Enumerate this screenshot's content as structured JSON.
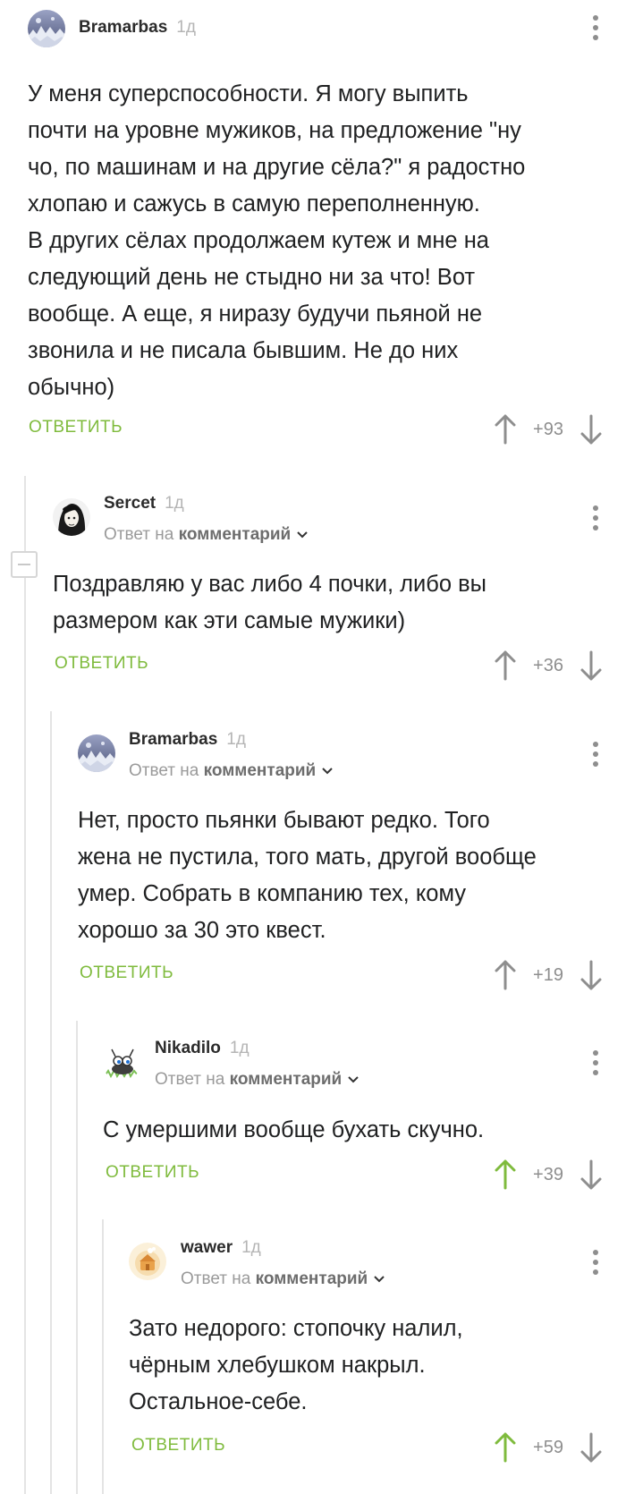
{
  "comments": [
    {
      "author": "Bramarbas",
      "age": "1д",
      "lines": [
        "У меня суперспособности. Я могу выпить",
        "почти на уровне мужиков, на предложение \"ну",
        "чо, по машинам и на другие сёла?\" я радостно",
        "хлопаю и сажусь в самую переполненную.",
        "В других сёлах продолжаем кутеж и мне на",
        "следующий день не стыдно ни за что! Вот",
        "вообще. А еще, я ниразу будучи пьяной не",
        "звонила и не писала бывшим. Не до них",
        "обычно)"
      ],
      "reply_label": "ОТВЕТИТЬ",
      "score": "+93",
      "upvoted": false
    },
    {
      "author": "Sercet",
      "age": "1д",
      "reply_prefix": "Ответ на",
      "reply_target": "комментарий",
      "lines": [
        "Поздравляю у вас либо 4 почки, либо вы",
        "размером как эти самые мужики)"
      ],
      "reply_label": "ОТВЕТИТЬ",
      "score": "+36",
      "upvoted": false
    },
    {
      "author": "Bramarbas",
      "age": "1д",
      "reply_prefix": "Ответ на",
      "reply_target": "комментарий",
      "lines": [
        "Нет, просто пьянки бывают редко. Того",
        "жена не пустила, того мать, другой вообще",
        "умер. Собрать в компанию тех, кому",
        "хорошо за 30 это квест."
      ],
      "reply_label": "ОТВЕТИТЬ",
      "score": "+19",
      "upvoted": false
    },
    {
      "author": "Nikadilo",
      "age": "1д",
      "reply_prefix": "Ответ на",
      "reply_target": "комментарий",
      "lines": [
        "С умершими вообще бухать скучно."
      ],
      "reply_label": "ОТВЕТИТЬ",
      "score": "+39",
      "upvoted": true
    },
    {
      "author": "wawer",
      "age": "1д",
      "reply_prefix": "Ответ на",
      "reply_target": "комментарий",
      "lines": [
        "Зато недорого: стопочку налил,",
        "чёрным хлебушком накрыл.",
        "Остальное-себе."
      ],
      "reply_label": "ОТВЕТИТЬ",
      "score": "+59",
      "upvoted": true
    }
  ],
  "icons": {
    "more": "more-vertical-icon",
    "up": "arrow-up-icon",
    "down": "arrow-down-icon",
    "chevron": "chevron-down-icon",
    "collapse": "collapse-thread-icon"
  },
  "colors": {
    "accent": "#7fbb3d",
    "text": "#202122",
    "muted": "#9a9a9a",
    "icon": "#8e8e8e",
    "thread_line": "#e4e4e4"
  }
}
